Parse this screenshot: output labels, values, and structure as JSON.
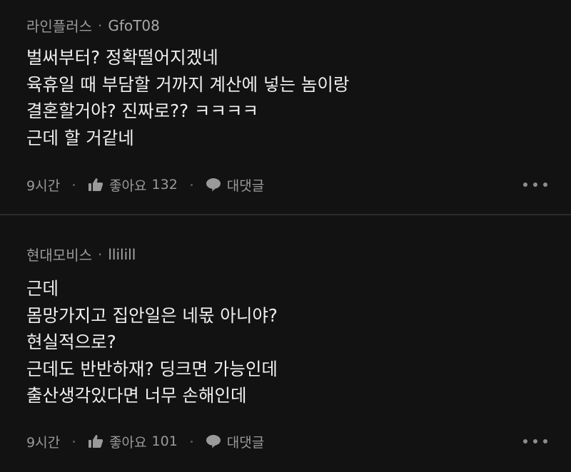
{
  "comments": [
    {
      "company": "라인플러스",
      "separator": "·",
      "nickname": "GfoT08",
      "lines": [
        "벌써부터? 정확떨어지겠네",
        "육휴일 때 부담할 거까지 계산에 넣는 놈이랑",
        "결혼할거야? 진짜로?? ㅋㅋㅋㅋ",
        "근데 할 거같네"
      ],
      "time": "9시간",
      "like_label": "좋아요",
      "like_count": "132",
      "reply_label": "대댓글"
    },
    {
      "company": "현대모비스",
      "separator": "·",
      "nickname": "llilill",
      "lines": [
        "근데",
        "몸망가지고 집안일은 네몫 아니야?",
        "현실적으로?",
        "근데도 반반하재? 딩크면 가능인데",
        "출산생각있다면 너무 손해인데"
      ],
      "time": "9시간",
      "like_label": "좋아요",
      "like_count": "101",
      "reply_label": "대댓글"
    }
  ],
  "icons": {
    "like": "thumbs-up-icon",
    "reply": "speech-bubble-icon",
    "more": "more-dots-icon"
  },
  "colors": {
    "background": "#121212",
    "text": "#f0f0f0",
    "muted": "#9a9a9a",
    "divider": "#2c2c2c"
  }
}
